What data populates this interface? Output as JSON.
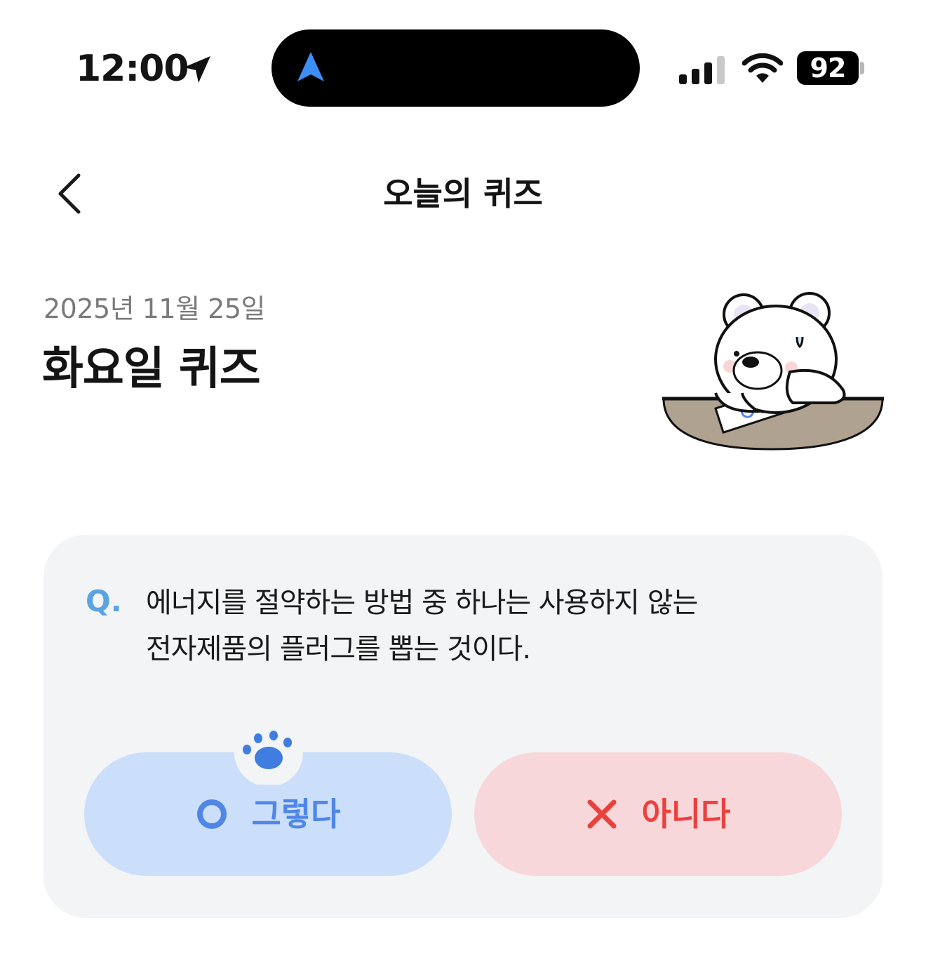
{
  "status_bar": {
    "time": "12:00",
    "battery": "92"
  },
  "nav": {
    "title": "오늘의 퀴즈"
  },
  "quiz": {
    "date": "2025년 11월 25일",
    "title": "화요일 퀴즈",
    "question_prefix": "Q.",
    "question_line1": "에너지를 절약하는 방법 중 하나는 사용하지 않는",
    "question_line2": "전자제품의 플러그를 뽑는 것이다.",
    "answer_yes_label": "그렇다",
    "answer_no_label": "아니다"
  },
  "colors": {
    "yes_accent": "#4f86e8",
    "no_accent": "#e8413e",
    "question_mark": "#5ba3e0"
  },
  "icons": {
    "back": "chevron-left-icon",
    "yes": "circle-o-icon",
    "no": "x-icon",
    "paw": "paw-icon"
  }
}
